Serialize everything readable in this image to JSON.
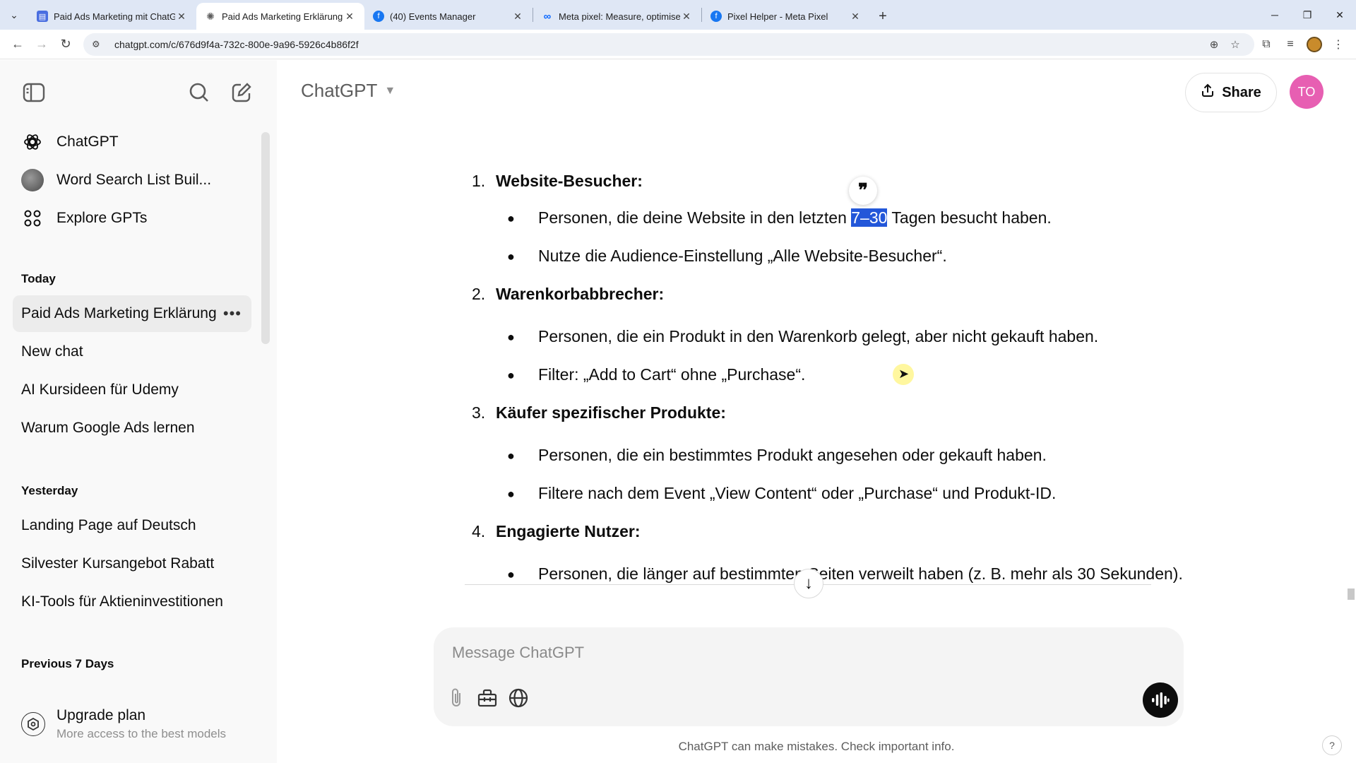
{
  "browser": {
    "tabs": [
      {
        "title": "Paid Ads Marketing mit ChatGPT",
        "active": false,
        "favicon": "doc-icon",
        "color": "#4a6ee0"
      },
      {
        "title": "Paid Ads Marketing Erklärung",
        "active": true,
        "favicon": "chatgpt-icon",
        "color": "#5d5d5d"
      },
      {
        "title": "(40) Events Manager",
        "active": false,
        "favicon": "facebook-icon",
        "color": "#1877f2"
      },
      {
        "title": "Meta pixel: Measure, optimise a",
        "active": false,
        "favicon": "meta-icon",
        "color": "#0866ff"
      },
      {
        "title": "Pixel Helper - Meta Pixel",
        "active": false,
        "favicon": "facebook-icon",
        "color": "#1877f2"
      }
    ],
    "url": "chatgpt.com/c/676d9f4a-732c-800e-9a96-5926c4b86f2f"
  },
  "sidebar": {
    "gpts": [
      {
        "label": "ChatGPT",
        "icon": "chatgpt-logo-icon"
      },
      {
        "label": "Word Search List Buil...",
        "icon": "gpt-avatar"
      },
      {
        "label": "Explore GPTs",
        "icon": "grid-icon"
      }
    ],
    "sections": [
      {
        "heading": "Today",
        "chats": [
          "Paid Ads Marketing Erklärung",
          "New chat",
          "AI Kursideen für Udemy",
          "Warum Google Ads lernen"
        ]
      },
      {
        "heading": "Yesterday",
        "chats": [
          "Landing Page auf Deutsch",
          "Silvester Kursangebot Rabatt",
          "KI-Tools für Aktieninvestitionen"
        ]
      },
      {
        "heading": "Previous 7 Days",
        "chats": []
      }
    ],
    "upgrade": {
      "title": "Upgrade plan",
      "subtitle": "More access to the best models"
    }
  },
  "header": {
    "model": "ChatGPT",
    "share_label": "Share",
    "user_initials": "TO",
    "avatar_color": "#e75fb2"
  },
  "message": {
    "items": [
      {
        "num": "1.",
        "label": "Website-Besucher:"
      },
      {
        "num": "2.",
        "label": "Warenkorbabbrecher:"
      },
      {
        "num": "3.",
        "label": "Käufer spezifischer Produkte:"
      },
      {
        "num": "4.",
        "label": "Engagierte Nutzer:"
      }
    ],
    "bullets": {
      "b1_pre": "Personen, die deine Website in den letzten ",
      "b1_highlight": "7–30",
      "b1_post": " Tagen besucht haben.",
      "b2": "Nutze die Audience-Einstellung „Alle Website-Besucher“.",
      "b3": "Personen, die ein Produkt in den Warenkorb gelegt, aber nicht gekauft haben.",
      "b4": "Filter: „Add to Cart“ ohne „Purchase“.",
      "b5": "Personen, die ein bestimmtes Produkt angesehen oder gekauft haben.",
      "b6": "Filtere nach dem Event „View Content“ oder „Purchase“ und Produkt-ID.",
      "b7": "Personen, die länger auf bestimmten Seiten verweilt haben (z. B. mehr als 30 Sekunden)."
    },
    "highlight_color": "#2357d9"
  },
  "composer": {
    "placeholder": "Message ChatGPT",
    "disclaimer": "ChatGPT can make mistakes. Check important info.",
    "help": "?"
  }
}
